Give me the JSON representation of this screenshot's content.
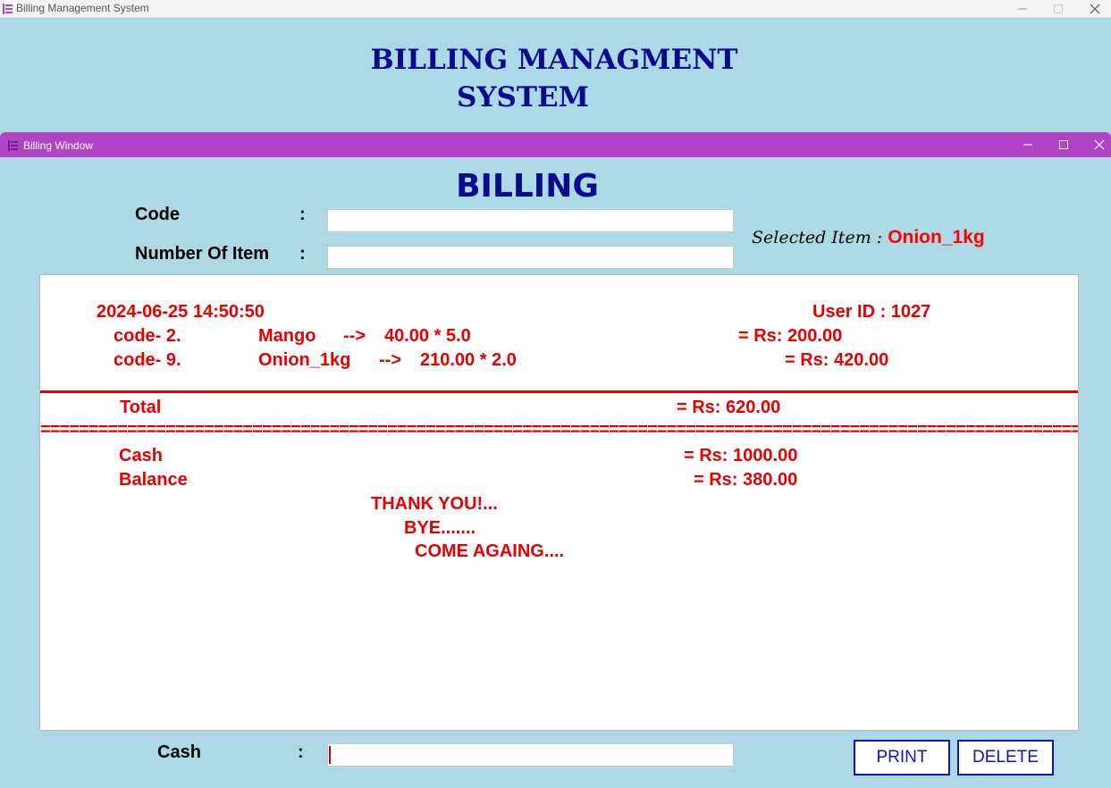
{
  "outer_window": {
    "title": "Billing Management System",
    "heading_line1": "BILLING MANAGMENT",
    "heading_line2": "SYSTEM"
  },
  "inner_window": {
    "title": "Billing Window",
    "heading": "BILLING"
  },
  "form": {
    "code_label": "Code",
    "number_label": "Number Of Item",
    "cash_label": "Cash",
    "colon": ":",
    "code_value": "",
    "number_value": "",
    "cash_value": ""
  },
  "selected_item": {
    "label": "Selected Item : ",
    "value": "Onion_1kg"
  },
  "receipt": {
    "datetime": "2024-06-25 14:50:50",
    "user_id": "User ID : 1027",
    "items": [
      {
        "code": "code- 2.",
        "name": "Mango",
        "arrow": "-->",
        "calc": "40.00 * 5.0",
        "amount": "= Rs: 200.00"
      },
      {
        "code": "code- 9.",
        "name": "Onion_1kg",
        "arrow": "-->",
        "calc": "210.00 * 2.0",
        "amount": "= Rs: 420.00"
      }
    ],
    "total_label": "Total",
    "total_value": "= Rs: 620.00",
    "separator": "==========================================================================================================================================",
    "cash_label": "Cash",
    "cash_value": "= Rs: 1000.00",
    "balance_label": "Balance",
    "balance_value": "= Rs: 380.00",
    "thanks": "THANK YOU!...",
    "bye": "BYE.......",
    "come_again": "COME AGAING...."
  },
  "buttons": {
    "print": "PRINT",
    "delete": "DELETE"
  },
  "colors": {
    "background": "#add8e6",
    "title_bar": "#b144c4",
    "heading": "#0a0a8c",
    "receipt_text": "#e60000",
    "button_border": "#1010c8"
  }
}
